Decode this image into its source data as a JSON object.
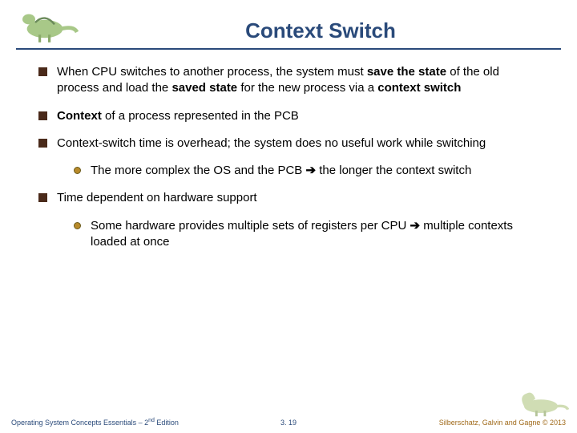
{
  "title": "Context Switch",
  "bullets": {
    "b1_pre": "When CPU switches to another process, the system must ",
    "b1_bold1": "save the state",
    "b1_mid1": " of the old process and load the ",
    "b1_bold2": "saved state",
    "b1_mid2": " for the new process via a ",
    "b1_bold3": "context switch",
    "b2_bold": "Context",
    "b2_rest": " of a process represented in the PCB",
    "b3": "Context-switch time is overhead; the system does no useful work while switching",
    "b3s_pre": "The more complex the OS and the PCB ",
    "b3s_arrow": "➔",
    "b3s_post": " the longer the context switch",
    "b4": "Time dependent on hardware support",
    "b4s_pre": "Some hardware provides multiple sets of registers per CPU ",
    "b4s_arrow": "➔",
    "b4s_post": " multiple contexts loaded at once"
  },
  "footer": {
    "left_pre": "Operating System Concepts Essentials – 2",
    "left_sup": "nd",
    "left_post": " Edition",
    "center": "3. 19",
    "right": "Silberschatz, Galvin and Gagne © 2013"
  }
}
